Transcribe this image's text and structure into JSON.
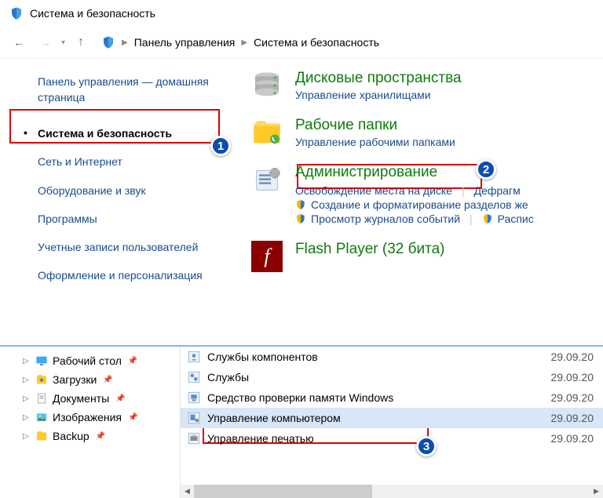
{
  "title": "Система и безопасность",
  "breadcrumb": {
    "item1": "Панель управления",
    "item2": "Система и безопасность"
  },
  "sidebar": {
    "home": "Панель управления — домашняя страница",
    "items": [
      {
        "label": "Система и безопасность"
      },
      {
        "label": "Сеть и Интернет"
      },
      {
        "label": "Оборудование и звук"
      },
      {
        "label": "Программы"
      },
      {
        "label": "Учетные записи пользователей"
      },
      {
        "label": "Оформление и персонализация"
      }
    ]
  },
  "groups": {
    "storage": {
      "title": "Дисковые пространства",
      "sub": "Управление хранилищами"
    },
    "workfolders": {
      "title": "Рабочие папки",
      "sub": "Управление рабочими папками"
    },
    "admin": {
      "title": "Администрирование",
      "link1": "Освобождение места на диске",
      "link2": "Дефрагм",
      "link3": "Создание и форматирование разделов же",
      "link4": "Просмотр журналов событий",
      "link5": "Распис"
    },
    "flash": {
      "title": "Flash Player (32 бита)"
    }
  },
  "tree": [
    {
      "label": "Рабочий стол",
      "pin": true,
      "exp": true
    },
    {
      "label": "Загрузки",
      "pin": true,
      "exp": true
    },
    {
      "label": "Документы",
      "pin": true,
      "exp": true
    },
    {
      "label": "Изображения",
      "pin": true,
      "exp": true
    },
    {
      "label": "Backup",
      "pin": true,
      "exp": true
    }
  ],
  "files": [
    {
      "name": "Службы компонентов",
      "date": "29.09.20"
    },
    {
      "name": "Службы",
      "date": "29.09.20"
    },
    {
      "name": "Средство проверки памяти Windows",
      "date": "29.09.20"
    },
    {
      "name": "Управление компьютером",
      "date": "29.09.20"
    },
    {
      "name": "Управление печатью",
      "date": "29.09.20"
    }
  ],
  "badges": {
    "b1": "1",
    "b2": "2",
    "b3": "3"
  }
}
